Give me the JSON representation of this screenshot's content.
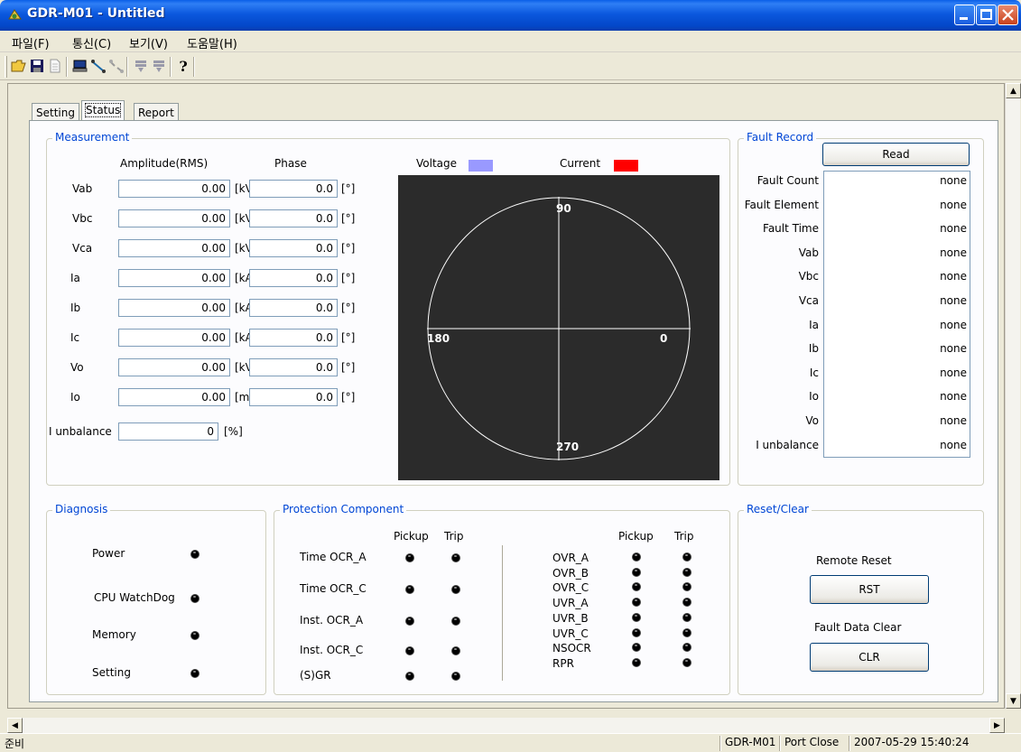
{
  "window": {
    "title": "GDR-M01 - Untitled"
  },
  "menu": [
    "파일(F)",
    "통신(C)",
    "보기(V)",
    "도움말(H)"
  ],
  "toolbar": {
    "icons": [
      "open-folder-icon",
      "save-icon",
      "document-icon",
      "computer-connect-icon",
      "connect-icon",
      "disconnect-icon",
      "download-icon",
      "upload-icon",
      "help-icon"
    ]
  },
  "tabs": [
    {
      "label": "Setting"
    },
    {
      "label": "Status",
      "active": true
    },
    {
      "label": "Report"
    }
  ],
  "measurement": {
    "title": "Measurement",
    "amplitude_header": "Amplitude(RMS)",
    "phase_header": "Phase",
    "rows": [
      {
        "label": "Vab",
        "amp": "0.00",
        "amp_unit": "[kV]",
        "phase": "0.0",
        "phase_unit": "[°]"
      },
      {
        "label": "Vbc",
        "amp": "0.00",
        "amp_unit": "[kV]",
        "phase": "0.0",
        "phase_unit": "[°]"
      },
      {
        "label": "Vca",
        "amp": "0.00",
        "amp_unit": "[kV]",
        "phase": "0.0",
        "phase_unit": "[°]"
      },
      {
        "label": "Ia",
        "amp": "0.00",
        "amp_unit": "[kA]",
        "phase": "0.0",
        "phase_unit": "[°]"
      },
      {
        "label": "Ib",
        "amp": "0.00",
        "amp_unit": "[kA]",
        "phase": "0.0",
        "phase_unit": "[°]"
      },
      {
        "label": "Ic",
        "amp": "0.00",
        "amp_unit": "[kA]",
        "phase": "0.0",
        "phase_unit": "[°]"
      },
      {
        "label": "Vo",
        "amp": "0.00",
        "amp_unit": "[kV]",
        "phase": "0.0",
        "phase_unit": "[°]"
      },
      {
        "label": "Io",
        "amp": "0.00",
        "amp_unit": "[mA]",
        "phase": "0.0",
        "phase_unit": "[°]"
      }
    ],
    "unbalance": {
      "label": "I unbalance",
      "value": "0",
      "unit": "[%]"
    },
    "legend": {
      "voltage_label": "Voltage",
      "voltage_color": "#9999ff",
      "current_label": "Current",
      "current_color": "#ff0000"
    },
    "phasor": {
      "label_90": "90",
      "label_180": "180",
      "label_0": "0",
      "label_270": "270",
      "background": "#2b2b2b"
    }
  },
  "fault_record": {
    "title": "Fault Record",
    "read_button": "Read",
    "rows": [
      {
        "label": "Fault Count",
        "value": "none"
      },
      {
        "label": "Fault Element",
        "value": "none"
      },
      {
        "label": "Fault Time",
        "value": "none"
      },
      {
        "label": "Vab",
        "value": "none"
      },
      {
        "label": "Vbc",
        "value": "none"
      },
      {
        "label": "Vca",
        "value": "none"
      },
      {
        "label": "Ia",
        "value": "none"
      },
      {
        "label": "Ib",
        "value": "none"
      },
      {
        "label": "Ic",
        "value": "none"
      },
      {
        "label": "Io",
        "value": "none"
      },
      {
        "label": "Vo",
        "value": "none"
      },
      {
        "label": "I unbalance",
        "value": "none"
      }
    ]
  },
  "diagnosis": {
    "title": "Diagnosis",
    "items": [
      "Power",
      "CPU WatchDog",
      "Memory",
      "Setting"
    ]
  },
  "protection": {
    "title": "Protection Component",
    "pickup_header": "Pickup",
    "trip_header": "Trip",
    "left_items": [
      "Time OCR_A",
      "Time OCR_C",
      "Inst. OCR_A",
      "Inst. OCR_C",
      "(S)GR"
    ],
    "right_items": [
      "OVR_A",
      "OVR_B",
      "OVR_C",
      "UVR_A",
      "UVR_B",
      "UVR_C",
      "NSOCR",
      "RPR"
    ]
  },
  "reset_clear": {
    "title": "Reset/Clear",
    "remote_reset_label": "Remote Reset",
    "rst_button": "RST",
    "fault_clear_label": "Fault Data Clear",
    "clr_button": "CLR"
  },
  "statusbar": {
    "left": "준비",
    "device": "GDR-M01",
    "port": "Port Close",
    "datetime": "2007-05-29 15:40:24"
  }
}
